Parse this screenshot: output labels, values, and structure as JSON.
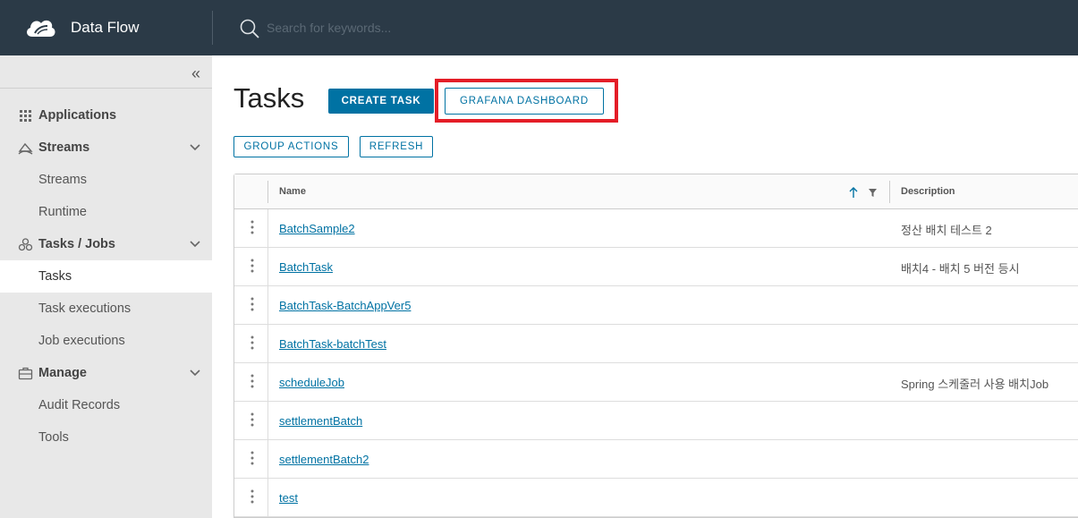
{
  "header": {
    "title": "Data Flow",
    "search_placeholder": "Search for keywords..."
  },
  "sidebar": {
    "collapse_icon": "double-chevron-left-icon",
    "items": [
      {
        "label": "Applications",
        "type": "group",
        "icon": "grid-icon"
      },
      {
        "label": "Streams",
        "type": "group",
        "icon": "streams-icon",
        "expandable": true
      },
      {
        "label": "Streams",
        "type": "sub"
      },
      {
        "label": "Runtime",
        "type": "sub"
      },
      {
        "label": "Tasks / Jobs",
        "type": "group",
        "icon": "tasks-icon",
        "expandable": true
      },
      {
        "label": "Tasks",
        "type": "sub",
        "active": true
      },
      {
        "label": "Task executions",
        "type": "sub"
      },
      {
        "label": "Job executions",
        "type": "sub"
      },
      {
        "label": "Manage",
        "type": "group",
        "icon": "briefcase-icon",
        "expandable": true
      },
      {
        "label": "Audit Records",
        "type": "sub"
      },
      {
        "label": "Tools",
        "type": "sub"
      }
    ]
  },
  "main": {
    "title": "Tasks",
    "buttons": {
      "create_task": "CREATE TASK",
      "grafana": "GRAFANA DASHBOARD",
      "group_actions": "GROUP ACTIONS",
      "refresh": "REFRESH"
    },
    "highlight_color": "#e41d27",
    "accent_color": "#0072a3",
    "table": {
      "columns": [
        "Name",
        "Description"
      ],
      "rows": [
        {
          "name": "BatchSample2",
          "description": "정산 배치 테스트 2"
        },
        {
          "name": "BatchTask",
          "description": "배치4 - 배치 5 버전 등시"
        },
        {
          "name": "BatchTask-BatchAppVer5",
          "description": ""
        },
        {
          "name": "BatchTask-batchTest",
          "description": ""
        },
        {
          "name": "scheduleJob",
          "description": "Spring 스케줄러 사용 배치Job"
        },
        {
          "name": "settlementBatch",
          "description": ""
        },
        {
          "name": "settlementBatch2",
          "description": ""
        },
        {
          "name": "test",
          "description": ""
        }
      ]
    }
  }
}
